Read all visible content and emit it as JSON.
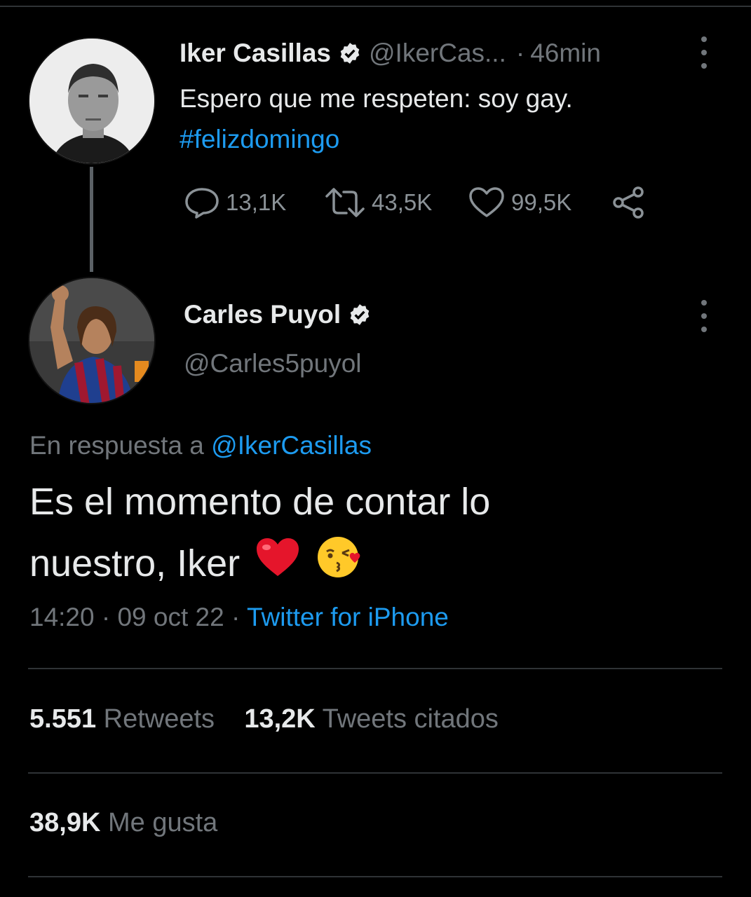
{
  "colors": {
    "background": "#000000",
    "text": "#e7e9ea",
    "muted": "#71767b",
    "accent": "#1d9bf0",
    "divider": "#2f3336"
  },
  "parent_tweet": {
    "author_name": "Iker Casillas",
    "verified_icon": "verified-badge-icon",
    "handle": "@IkerCas...",
    "separator": "·",
    "time": "46min",
    "text": "Espero que me respeten: soy gay.",
    "hashtag": "#felizdomingo",
    "actions": {
      "reply_icon": "reply-icon",
      "reply_count": "13,1K",
      "retweet_icon": "retweet-icon",
      "retweet_count": "43,5K",
      "like_icon": "heart-icon",
      "like_count": "99,5K",
      "share_icon": "share-icon"
    }
  },
  "reply_tweet": {
    "author_name": "Carles Puyol",
    "verified_icon": "verified-badge-icon",
    "handle": "@Carles5puyol",
    "reply_prefix": "En respuesta a",
    "reply_mention": "@IkerCasillas",
    "text_line1": "Es el momento de contar lo",
    "text_line2": "nuestro, Iker",
    "emojis": [
      "red-heart-emoji",
      "kiss-face-emoji"
    ],
    "time": "14:20",
    "date": "09 oct 22",
    "separator": "·",
    "source": "Twitter for iPhone"
  },
  "stats": {
    "retweets_count": "5.551",
    "retweets_label": "Retweets",
    "quotes_count": "13,2K",
    "quotes_label": "Tweets citados",
    "likes_count": "38,9K",
    "likes_label": "Me gusta"
  }
}
